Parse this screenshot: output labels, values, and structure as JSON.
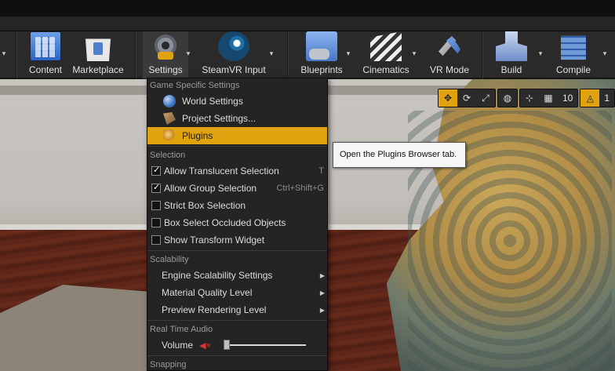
{
  "toolbar": {
    "buttons": [
      {
        "label": "Content",
        "icon": "content-browser-icon"
      },
      {
        "label": "Marketplace",
        "icon": "marketplace-icon"
      },
      {
        "label": "Settings",
        "icon": "settings-gear-icon"
      },
      {
        "label": "SteamVR Input",
        "icon": "steam-icon"
      },
      {
        "label": "Blueprints",
        "icon": "blueprints-icon"
      },
      {
        "label": "Cinematics",
        "icon": "clapperboard-icon"
      },
      {
        "label": "VR Mode",
        "icon": "vr-mode-icon"
      },
      {
        "label": "Build",
        "icon": "build-icon"
      },
      {
        "label": "Compile",
        "icon": "compile-icon"
      }
    ]
  },
  "viewport_toolbar": {
    "grid_snap_value": "10",
    "rotation_snap_value": "1"
  },
  "menu": {
    "sections": {
      "game_specific": "Game Specific Settings",
      "selection": "Selection",
      "scalability": "Scalability",
      "realtime_audio": "Real Time Audio",
      "next_section_partial": "Snapping"
    },
    "items": {
      "world_settings": "World Settings",
      "project_settings": "Project Settings...",
      "plugins": "Plugins",
      "allow_translucent": "Allow Translucent Selection",
      "allow_translucent_shortcut": "T",
      "allow_group": "Allow Group Selection",
      "allow_group_shortcut": "Ctrl+Shift+G",
      "strict_box": "Strict Box Selection",
      "box_select_occluded": "Box Select Occluded Objects",
      "show_transform_widget": "Show Transform Widget",
      "engine_scalability": "Engine Scalability Settings",
      "material_quality": "Material Quality Level",
      "preview_rendering": "Preview Rendering Level",
      "volume": "Volume"
    },
    "checks": {
      "allow_translucent": true,
      "allow_group": true,
      "strict_box": false,
      "box_select_occluded": false,
      "show_transform_widget": false
    },
    "volume_level": 0.0
  },
  "tooltip": {
    "text": "Open the Plugins Browser tab."
  },
  "colors": {
    "highlight": "#e0a20f",
    "menu_bg": "#242424",
    "toolbar_bg": "#2a2a2a"
  }
}
